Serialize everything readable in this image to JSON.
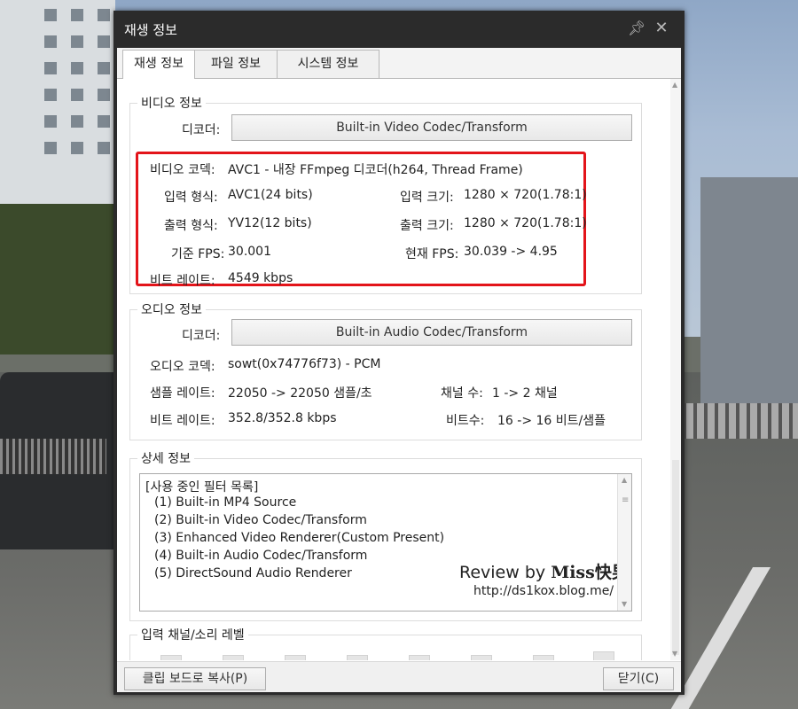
{
  "window": {
    "title": "재생 정보"
  },
  "tabs": [
    {
      "label": "재생 정보",
      "active": true
    },
    {
      "label": "파일 정보",
      "active": false
    },
    {
      "label": "시스템 정보",
      "active": false
    }
  ],
  "video": {
    "section_label": "비디오 정보",
    "decoder_label": "디코더:",
    "decoder_button": "Built-in Video Codec/Transform",
    "codec_label": "비디오 코덱:",
    "codec_value": "AVC1 - 내장 FFmpeg 디코더(h264, Thread Frame)",
    "input_format_label": "입력 형식:",
    "input_format_value": "AVC1(24 bits)",
    "input_size_label": "입력 크기:",
    "input_size_value": "1280 × 720(1.78:1)",
    "output_format_label": "출력 형식:",
    "output_format_value": "YV12(12 bits)",
    "output_size_label": "출력 크기:",
    "output_size_value": "1280 × 720(1.78:1)",
    "base_fps_label": "기준 FPS:",
    "base_fps_value": "30.001",
    "current_fps_label": "현재 FPS:",
    "current_fps_value": "30.039 -> 4.95",
    "bitrate_label": "비트 레이트:",
    "bitrate_value": "4549 kbps"
  },
  "audio": {
    "section_label": "오디오 정보",
    "decoder_label": "디코더:",
    "decoder_button": "Built-in Audio Codec/Transform",
    "codec_label": "오디오 코덱:",
    "codec_value": "sowt(0x74776f73) - PCM",
    "sample_rate_label": "샘플 레이트:",
    "sample_rate_value": "22050 -> 22050 샘플/초",
    "channels_label": "채널 수:",
    "channels_value": "1 -> 2 채널",
    "bitrate_label": "비트 레이트:",
    "bitrate_value": "352.8/352.8 kbps",
    "bits_label": "비트수:",
    "bits_value": "16 -> 16 비트/샘플"
  },
  "detail": {
    "section_label": "상세 정보",
    "lines": [
      "[사용 중인 필터 목록]",
      "(1) Built-in MP4 Source",
      "(2) Built-in Video Codec/Transform",
      "(3) Enhanced Video Renderer(Custom Present)",
      "(4) Built-in Audio Codec/Transform",
      "(5) DirectSound Audio Renderer"
    ],
    "watermark_prefix": "Review by",
    "watermark_brand": "Miss快男™",
    "watermark_url": "http://ds1kox.blog.me/"
  },
  "level": {
    "section_label": "입력 채널/소리 레벨"
  },
  "footer": {
    "copy_button": "클립 보드로 복사(P)",
    "close_button": "닫기(C)"
  }
}
